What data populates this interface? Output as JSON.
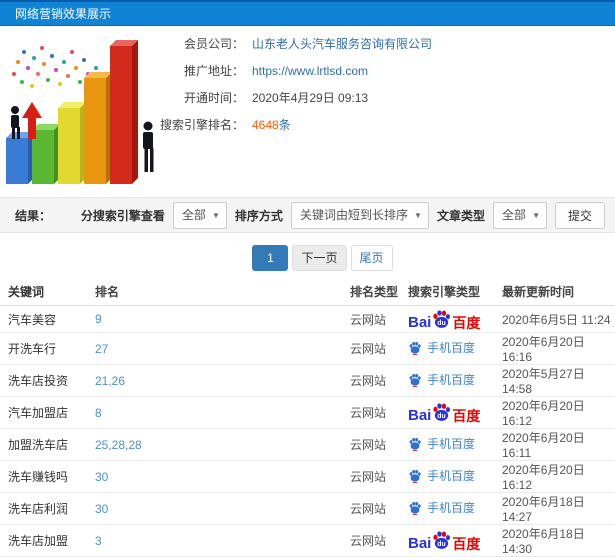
{
  "colors": {
    "topbar_blue": "#1183d4",
    "link_blue": "#2f6da8",
    "highlight_orange": "#ff5a00",
    "pagination_active": "#337ab7",
    "rank_link_blue": "#4a90d2",
    "baidu_blue": "#2932e1",
    "baidu_red": "#e60601",
    "filter_bar_bg": "#f4f4f4"
  },
  "header": {
    "title": "网络营销效果展示"
  },
  "info": {
    "member_label": "会员公司：",
    "member_value": "山东老人头汽车服务咨询有限公司",
    "url_label": "推广地址：",
    "url_value": "https://www.lrtlsd.com",
    "open_label": "开通时间：",
    "open_value": "2020年4月29日 09:13",
    "rank_label": "搜索引擎排名：",
    "rank_count": "4648",
    "rank_unit": "条"
  },
  "filters": {
    "result_label": "结果：",
    "engine_label": "分搜索引擎查看",
    "engine_value": "全部",
    "sort_label": "排序方式",
    "sort_value": "关键词由短到长排序",
    "type_label": "文章类型",
    "type_value": "全部",
    "submit_label": "提交",
    "caret": "▼"
  },
  "pagination": {
    "current": "1",
    "next_label": "下一页",
    "last_label": "尾页"
  },
  "engines": {
    "baidu": {
      "part1": "Bai",
      "part2": "du",
      "part3": "百度"
    },
    "mobile": {
      "label": "手机百度"
    }
  },
  "table": {
    "columns": [
      "关键词",
      "排名",
      "排名类型",
      "搜索引擎类型",
      "最新更新时间"
    ],
    "rows": [
      {
        "keyword": "汽车美容",
        "rank": "9",
        "rank_type": "云网站",
        "engine": "baidu",
        "updated": "2020年6月5日 11:24"
      },
      {
        "keyword": "开洗车行",
        "rank": "27",
        "rank_type": "云网站",
        "engine": "mobile",
        "updated": "2020年6月20日 16:16"
      },
      {
        "keyword": "洗车店投资",
        "rank": "21,26",
        "rank_type": "云网站",
        "engine": "mobile",
        "updated": "2020年5月27日 14:58"
      },
      {
        "keyword": "汽车加盟店",
        "rank": "8",
        "rank_type": "云网站",
        "engine": "baidu",
        "updated": "2020年6月20日 16:12"
      },
      {
        "keyword": "加盟洗车店",
        "rank": "25,28,28",
        "rank_type": "云网站",
        "engine": "mobile",
        "updated": "2020年6月20日 16:11"
      },
      {
        "keyword": "洗车赚钱吗",
        "rank": "30",
        "rank_type": "云网站",
        "engine": "mobile",
        "updated": "2020年6月20日 16:12"
      },
      {
        "keyword": "洗车店利润",
        "rank": "30",
        "rank_type": "云网站",
        "engine": "mobile",
        "updated": "2020年6月18日 14:27"
      },
      {
        "keyword": "洗车店加盟",
        "rank": "3",
        "rank_type": "云网站",
        "engine": "baidu",
        "updated": "2020年6月18日 14:30"
      }
    ]
  }
}
